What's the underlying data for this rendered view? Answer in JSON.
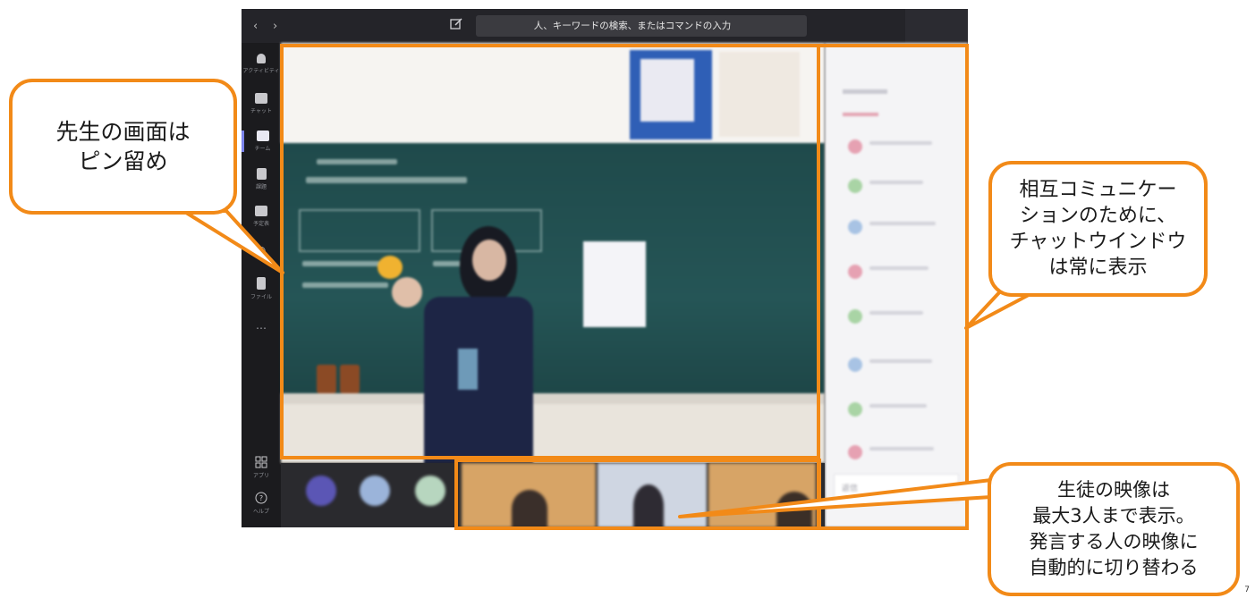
{
  "topbar": {
    "back_icon": "chevron-left-icon",
    "forward_icon": "chevron-right-icon",
    "search_placeholder": "人、キーワードの検索、またはコマンドの入力"
  },
  "app_rail": {
    "items": [
      {
        "icon": "bell-icon",
        "label": "アクティビティ"
      },
      {
        "icon": "chat-icon",
        "label": "チャット"
      },
      {
        "icon": "teams-icon",
        "label": "チーム"
      },
      {
        "icon": "assignments-icon",
        "label": "課題"
      },
      {
        "icon": "calendar-icon",
        "label": "予定表"
      },
      {
        "icon": "phone-icon",
        "label": ""
      },
      {
        "icon": "files-icon",
        "label": "ファイル"
      },
      {
        "icon": "more-icon",
        "label": ""
      }
    ],
    "apps_label": "アプリ",
    "help_label": "ヘルプ"
  },
  "chat_panel": {
    "reply_label": "返信"
  },
  "callouts": {
    "pinned": [
      "先生の画面は",
      "ピン留め"
    ],
    "chat": [
      "相互コミュニケー",
      "ションのために、",
      "チャットウインドウ",
      "は常に表示"
    ],
    "students": [
      "生徒の映像は",
      "最大3人まで表示。",
      "発言する人の映像に",
      "自動的に切り替わる"
    ]
  },
  "colors": {
    "accent_orange": "#f28a18",
    "teams_rail": "#1b1b1e",
    "teams_active": "#7b83eb"
  },
  "page_number": "7"
}
